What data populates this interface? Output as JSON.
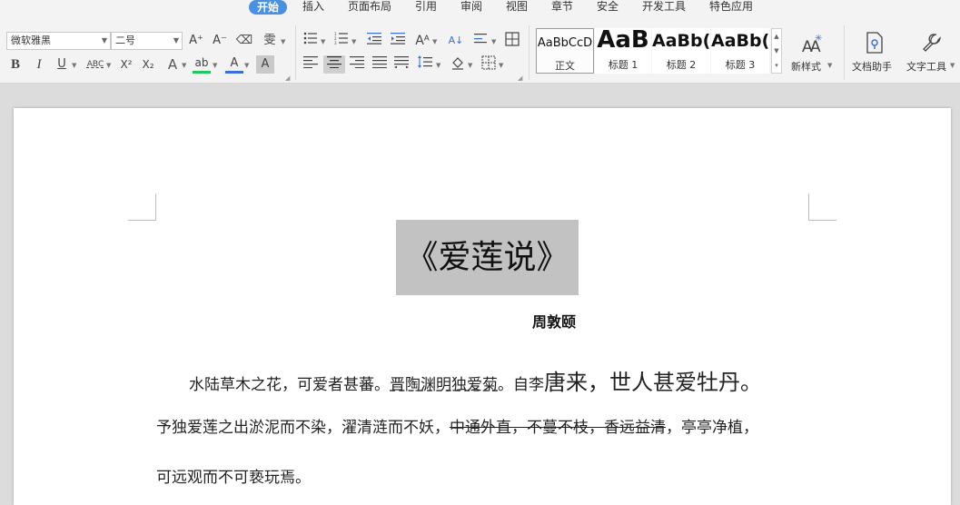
{
  "menu": {
    "tabs": [
      "开始",
      "插入",
      "页面布局",
      "引用",
      "审阅",
      "视图",
      "章节",
      "安全",
      "开发工具",
      "特色应用"
    ],
    "active": "开始"
  },
  "ribbon": {
    "font_name": "微软雅黑",
    "font_size": "二号",
    "styles": [
      {
        "sample": "AaBbCcD",
        "label": "正文"
      },
      {
        "sample": "AaB",
        "label": "标题 1"
      },
      {
        "sample": "AaBb(",
        "label": "标题 2"
      },
      {
        "sample": "AaBb(",
        "label": "标题 3"
      }
    ],
    "new_style_label": "新样式",
    "doc_assistant_label": "文档助手",
    "text_tools_label": "文字工具",
    "glyphs": {
      "grow_font": "A⁺",
      "shrink_font": "A⁻",
      "clear_format": "⌫",
      "phonetic": "雯",
      "bold": "B",
      "italic": "I",
      "underline": "U",
      "abc": "ABC",
      "superscript": "X²",
      "subscript": "X₂",
      "text_effect": "A",
      "highlight": "ab",
      "font_color": "A",
      "char_shading": "A"
    }
  },
  "document": {
    "title": "《爱莲说》",
    "author": "周敦颐",
    "p1": {
      "a": "水陆草木之花，可爱者甚蕃。",
      "b": "晋陶渊明独爱菊",
      "c": "。自李",
      "d": "唐来，世人甚爱牡丹。"
    },
    "p2": {
      "a": "予独爱莲之出淤泥而不染，濯清涟而不妖，",
      "b": "中通外直，不蔓不枝，香远益清",
      "c": "，亭亭净植，"
    },
    "p3": "可远观而不可亵玩焉。"
  },
  "colors": {
    "accent": "#4a90e2",
    "title_highlight": "#c2c2c2",
    "highlight_green": "#22c55e",
    "font_color_blue": "#3b6fd6"
  }
}
